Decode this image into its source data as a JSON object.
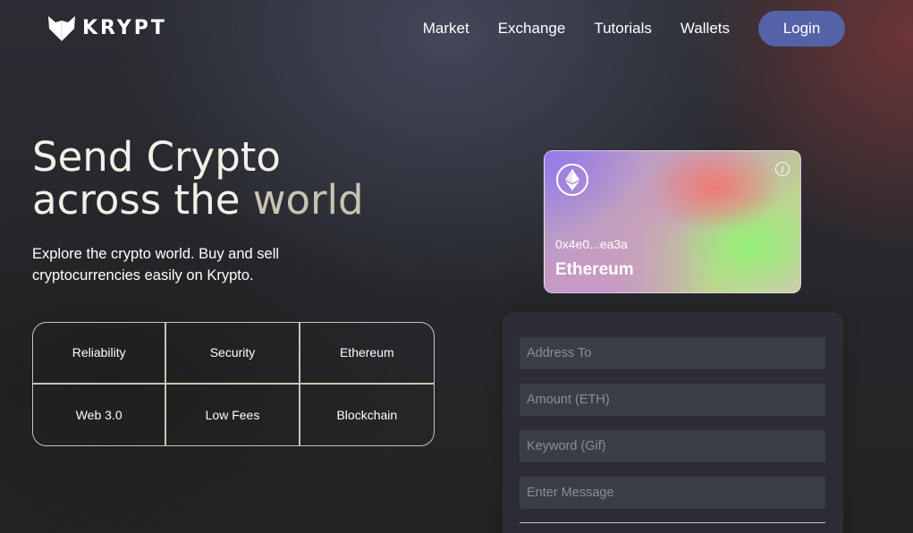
{
  "brand": {
    "name": "KRYPT"
  },
  "nav": {
    "links": [
      "Market",
      "Exchange",
      "Tutorials",
      "Wallets"
    ],
    "login_label": "Login"
  },
  "hero": {
    "title_line1": "Send Crypto",
    "title_line2_a": "across the ",
    "title_line2_b": "world",
    "description": "Explore the crypto world. Buy and sell cryptocurrencies easily on Krypto."
  },
  "features": [
    "Reliability",
    "Security",
    "Ethereum",
    "Web 3.0",
    "Low Fees",
    "Blockchain"
  ],
  "card": {
    "address": "0x4e0...ea3a",
    "network": "Ethereum",
    "icon": "ethereum-icon",
    "info_glyph": "i"
  },
  "form": {
    "address_placeholder": "Address To",
    "amount_placeholder": "Amount (ETH)",
    "keyword_placeholder": "Keyword (Gif)",
    "message_placeholder": "Enter Message"
  },
  "colors": {
    "accent": "#5463a8",
    "grid_border": "#c9c3b3",
    "field_bg": "#3a3c47"
  }
}
